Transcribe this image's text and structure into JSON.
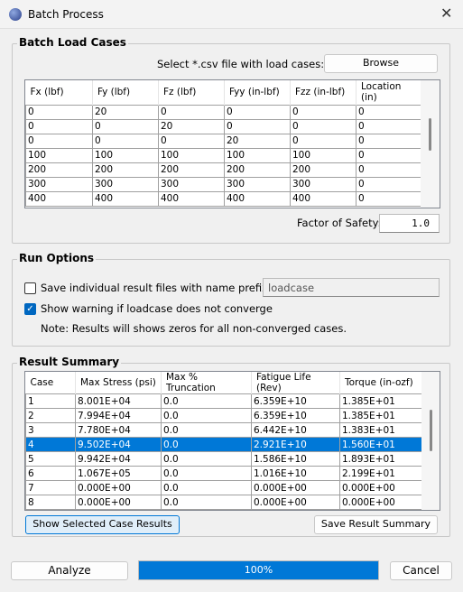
{
  "window": {
    "title": "Batch Process"
  },
  "load_cases": {
    "group_label": "Batch Load Cases",
    "select_label": "Select *.csv file with load cases:",
    "browse_label": "Browse",
    "columns": [
      "Fx (lbf)",
      "Fy (lbf)",
      "Fz (lbf)",
      "Fyy (in-lbf)",
      "Fzz (in-lbf)",
      "Location (in)"
    ],
    "rows": [
      [
        "0",
        "20",
        "0",
        "0",
        "0",
        "0"
      ],
      [
        "0",
        "0",
        "20",
        "0",
        "0",
        "0"
      ],
      [
        "0",
        "0",
        "0",
        "20",
        "0",
        "0"
      ],
      [
        "100",
        "100",
        "100",
        "100",
        "100",
        "0"
      ],
      [
        "200",
        "200",
        "200",
        "200",
        "200",
        "0"
      ],
      [
        "300",
        "300",
        "300",
        "300",
        "300",
        "0"
      ],
      [
        "400",
        "400",
        "400",
        "400",
        "400",
        "0"
      ]
    ],
    "fos_label": "Factor of Safety:",
    "fos_value": "1.0"
  },
  "run_options": {
    "group_label": "Run Options",
    "save_individual_label": "Save individual result files with name prefix:",
    "save_individual_checked": false,
    "prefix_value": "loadcase",
    "show_warning_label": "Show warning if loadcase does not converge",
    "show_warning_checked": true,
    "note": "Note: Results will shows zeros for all non-converged cases."
  },
  "results": {
    "group_label": "Result Summary",
    "columns": [
      "Case",
      "Max Stress (psi)",
      "Max % Truncation",
      "Fatigue Life (Rev)",
      "Torque (in-ozf)"
    ],
    "rows": [
      [
        "1",
        "8.001E+04",
        "0.0",
        "6.359E+10",
        "1.385E+01"
      ],
      [
        "2",
        "7.994E+04",
        "0.0",
        "6.359E+10",
        "1.385E+01"
      ],
      [
        "3",
        "7.780E+04",
        "0.0",
        "6.442E+10",
        "1.383E+01"
      ],
      [
        "4",
        "9.502E+04",
        "0.0",
        "2.921E+10",
        "1.560E+01"
      ],
      [
        "5",
        "9.942E+04",
        "0.0",
        "1.586E+10",
        "1.893E+01"
      ],
      [
        "6",
        "1.067E+05",
        "0.0",
        "1.016E+10",
        "2.199E+01"
      ],
      [
        "7",
        "0.000E+00",
        "0.0",
        "0.000E+00",
        "0.000E+00"
      ],
      [
        "8",
        "0.000E+00",
        "0.0",
        "0.000E+00",
        "0.000E+00"
      ]
    ],
    "selected_row": "4",
    "show_selected_label": "Show Selected Case Results",
    "save_summary_label": "Save Result Summary"
  },
  "footer": {
    "analyze_label": "Analyze",
    "progress_text": "100%",
    "progress_percent": 100,
    "cancel_label": "Cancel"
  },
  "colors": {
    "accent": "#0078d7"
  }
}
